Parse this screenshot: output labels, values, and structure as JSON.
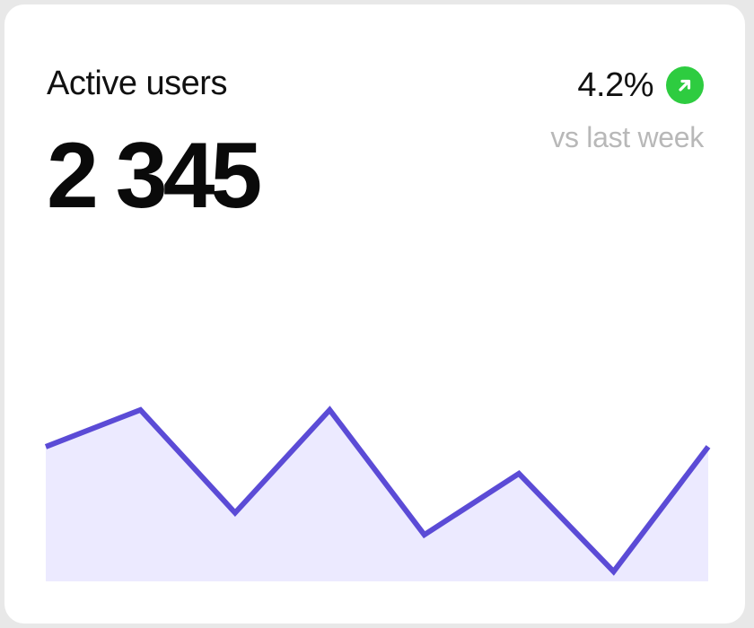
{
  "card": {
    "title": "Active users",
    "value": "2 345",
    "delta": "4.2%",
    "delta_icon": "arrow-up-right-icon",
    "comparison": "vs last week"
  },
  "colors": {
    "positive": "#2ecc40",
    "line": "#5b4bd6",
    "area": "#eceaff",
    "muted_text": "#b8b8b8"
  },
  "chart_data": {
    "type": "area",
    "values": [
      0.55,
      0.7,
      0.28,
      0.7,
      0.19,
      0.44,
      0.04,
      0.55
    ],
    "ylim": [
      0,
      1
    ],
    "grid": false,
    "legend": "none"
  }
}
